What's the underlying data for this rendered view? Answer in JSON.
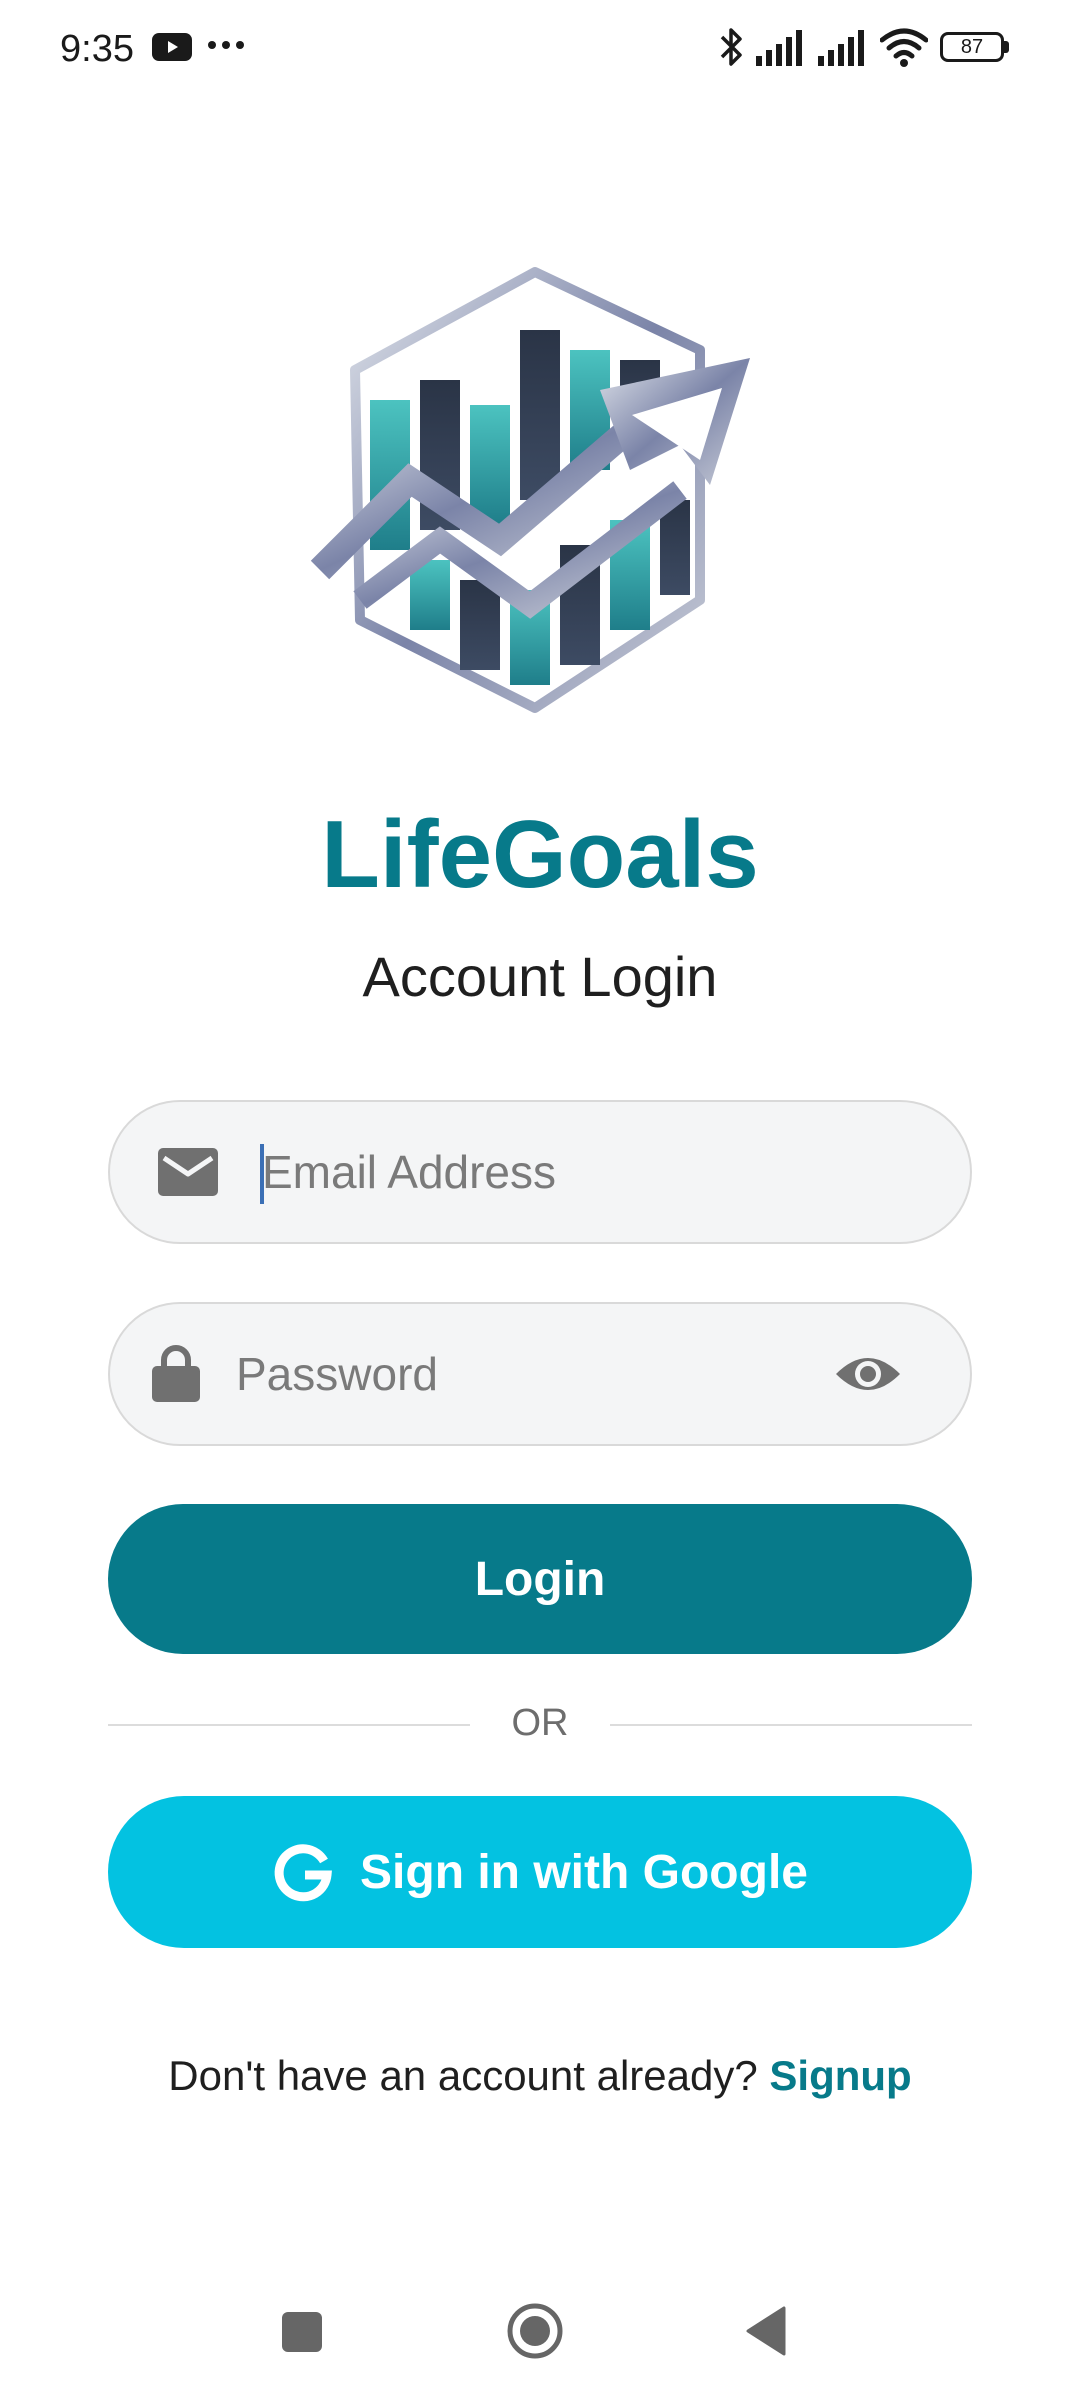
{
  "status_bar": {
    "time": "9:35",
    "battery": "87"
  },
  "app": {
    "title": "LifeGoals",
    "subtitle": "Account Login"
  },
  "form": {
    "email_placeholder": "Email Address",
    "password_placeholder": "Password",
    "login_label": "Login",
    "or_label": "OR",
    "google_label": "Sign in with Google"
  },
  "signup": {
    "prompt": "Don't have an account already? ",
    "link": "Signup"
  },
  "colors": {
    "primary": "#077a8a",
    "google_button": "#03c2e1",
    "input_background": "#f4f5f6"
  },
  "icons": [
    "youtube-icon",
    "more-icon",
    "bluetooth-icon",
    "signal-icon",
    "wifi-icon",
    "battery-icon",
    "mail-icon",
    "lock-icon",
    "eye-icon",
    "google-icon",
    "recent-apps-icon",
    "home-icon",
    "back-icon"
  ]
}
